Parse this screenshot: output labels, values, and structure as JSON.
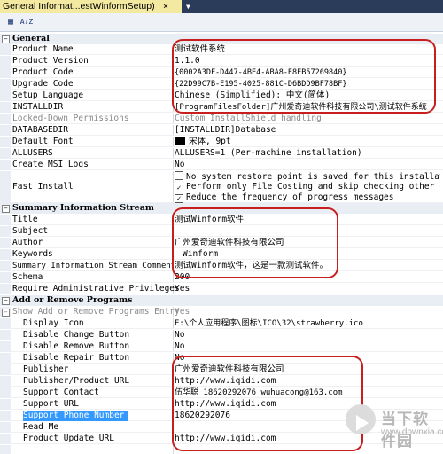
{
  "tab": {
    "title": "General Informat...estWinformSetup)",
    "close": "×"
  },
  "toolbar": {
    "categorized_label": "▦",
    "sort_label": "A↓Z"
  },
  "sections": {
    "general": {
      "label": "General",
      "expander": "−"
    },
    "summary": {
      "label": "Summary Information Stream",
      "expander": "−"
    },
    "addremove": {
      "label": "Add or Remove Programs",
      "expander": "−"
    }
  },
  "general": [
    {
      "name": "Product Name",
      "value": "测试软件系统"
    },
    {
      "name": "Product Version",
      "value": "1.1.0"
    },
    {
      "name": "Product Code",
      "value": "{0002A3DF-D447-4BE4-ABA8-E8EB57269840}"
    },
    {
      "name": "Upgrade Code",
      "value": "{22D99C7B-E195-4025-881C-D6BDD9BF78BF}"
    },
    {
      "name": "Setup Language",
      "value": "Chinese (Simplified): 中文(简体)"
    },
    {
      "name": "INSTALLDIR",
      "value": "[ProgramFilesFolder]广州爱奇迪软件科技有限公司\\测试软件系统"
    },
    {
      "name": "Locked-Down Permissions",
      "value": "Custom InstallShield handling"
    },
    {
      "name": "DATABASEDIR",
      "value": "[INSTALLDIR]Database"
    },
    {
      "name": "Default Font",
      "value": "宋体, 9pt"
    },
    {
      "name": "ALLUSERS",
      "value": "ALLUSERS=1 (Per-machine installation)"
    },
    {
      "name": "Create MSI Logs",
      "value": "No"
    },
    {
      "name": "Fast Install",
      "options": [
        {
          "label": "No system restore point is saved for this installation",
          "checked": false
        },
        {
          "label": "Perform only File Costing and skip checking other costs",
          "checked": true
        },
        {
          "label": "Reduce the frequency of progress messages",
          "checked": true
        }
      ]
    }
  ],
  "summary": [
    {
      "name": "Title",
      "value": "测试Winform软件"
    },
    {
      "name": "Subject",
      "value": ""
    },
    {
      "name": "Author",
      "value": "广州爱奇迪软件科技有限公司"
    },
    {
      "name": "Keywords",
      "value": "Winform"
    },
    {
      "name": "Summary Information Stream Comments",
      "value": "测试Winform软件，这是一款测试软件。"
    },
    {
      "name": "Schema",
      "value": "200"
    },
    {
      "name": "Require Administrative Privileges",
      "value": "Yes"
    }
  ],
  "addremove": [
    {
      "name": "Show Add or Remove Programs Entry",
      "value": "Yes"
    },
    {
      "name": "Display Icon",
      "value": "E:\\个人应用程序\\图标\\ICO\\32\\strawberry.ico"
    },
    {
      "name": "Disable Change Button",
      "value": "No"
    },
    {
      "name": "Disable Remove Button",
      "value": "No"
    },
    {
      "name": "Disable Repair Button",
      "value": "No"
    },
    {
      "name": "Publisher",
      "value": "广州爱奇迪软件科技有限公司"
    },
    {
      "name": "Publisher/Product URL",
      "value": "http://www.iqidi.com"
    },
    {
      "name": "Support Contact",
      "value": "伍华聪 18620292076 wuhuacong@163.com"
    },
    {
      "name": "Support URL",
      "value": "http://www.iqidi.com"
    },
    {
      "name": "Support Phone Number",
      "value": "18620292076"
    },
    {
      "name": "Read Me",
      "value": ""
    },
    {
      "name": "Product Update URL",
      "value": "http://www.iqidi.com"
    }
  ],
  "watermark": {
    "title": "当下软件园",
    "url": "www.downxia.com"
  },
  "colors": {
    "tab_bg": "#f3e9a0",
    "selection": "#3399ff",
    "annotation": "#c81e1e"
  }
}
